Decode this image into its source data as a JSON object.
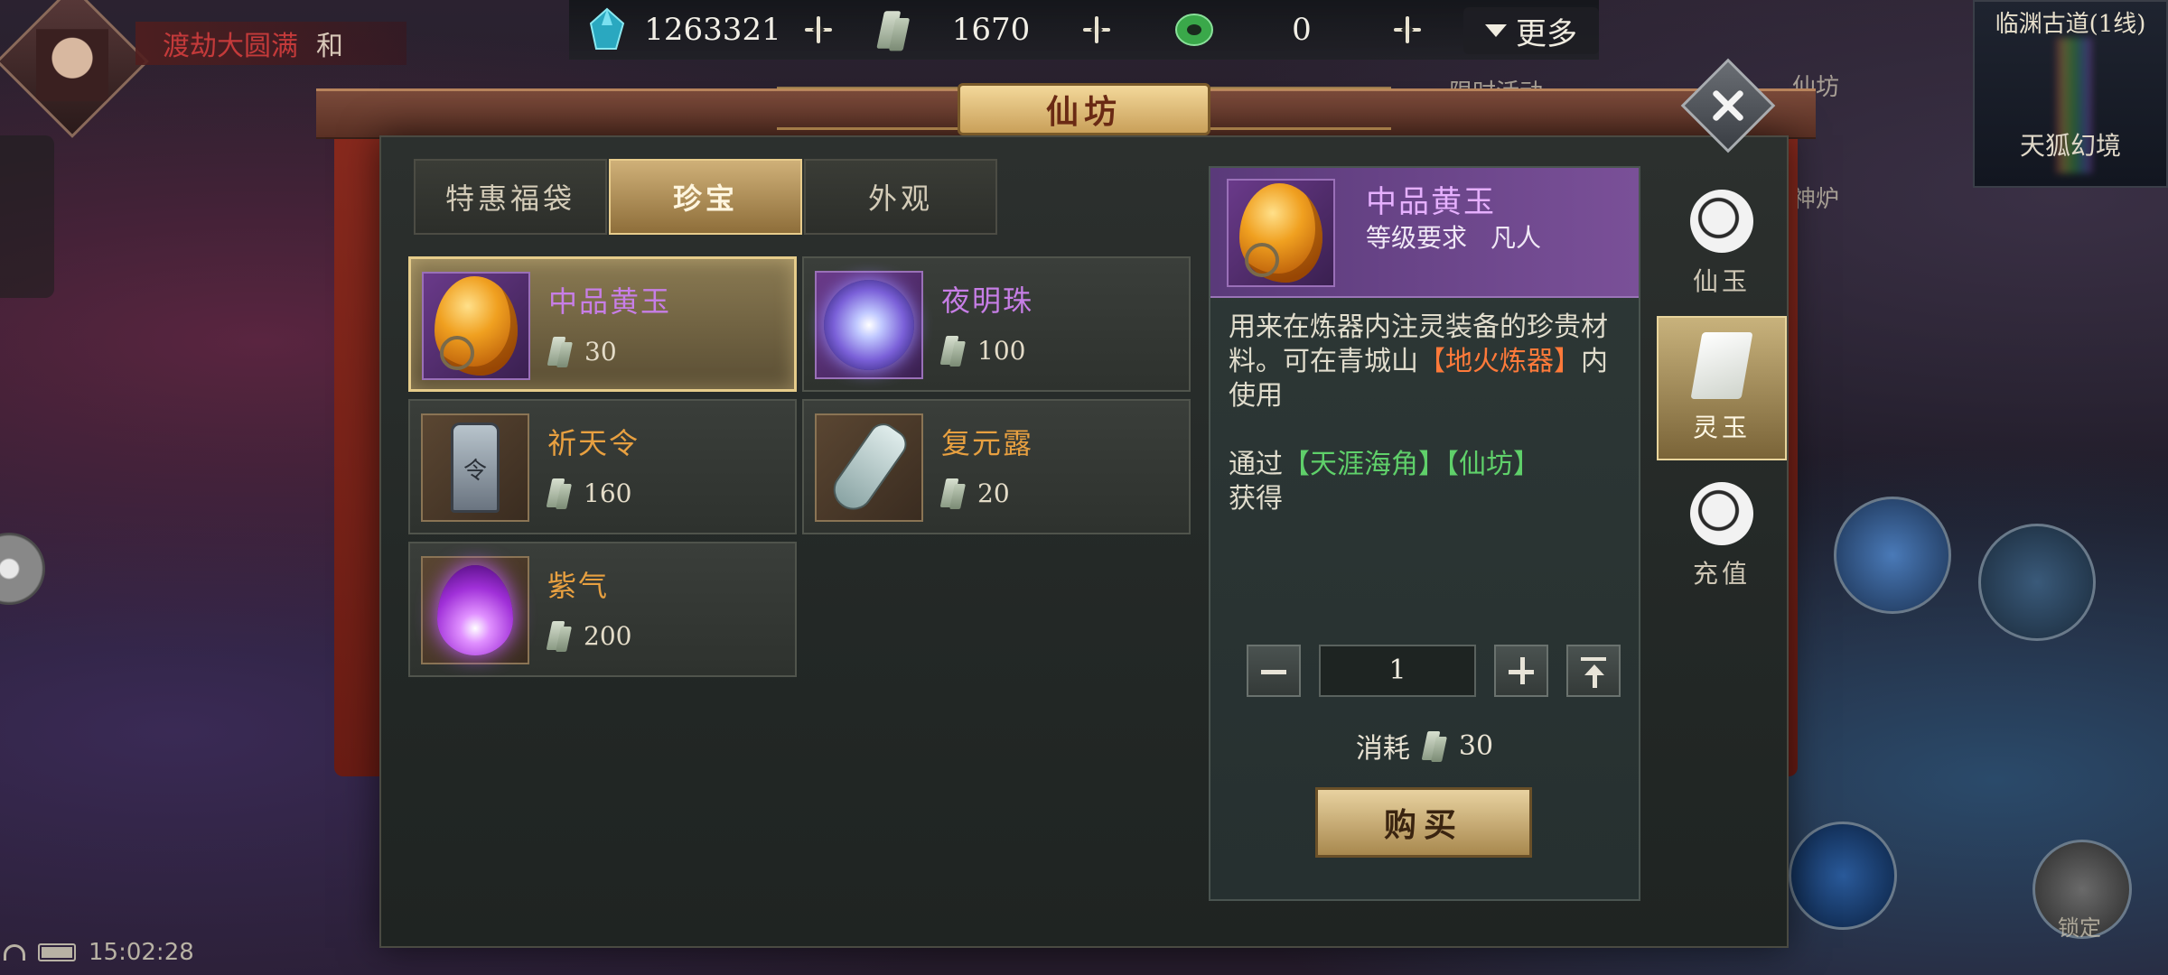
{
  "player": {
    "realm": "渡劫大圆满",
    "server_tag": "和"
  },
  "currencies": [
    {
      "name": "spirit-crystal",
      "value": "1263321",
      "icon": "crystal-icon",
      "color": "#3ab8c8"
    },
    {
      "name": "spirit-jade",
      "value": "1670",
      "icon": "jade-token-icon",
      "color": "#c0ccb8"
    },
    {
      "name": "jade-ring",
      "value": "0",
      "icon": "jade-ring-icon",
      "color": "#4ac060"
    }
  ],
  "more_label": "更多",
  "hud": {
    "limited_event": "限时活动",
    "xian_fang": "仙坊",
    "shen_lu": "神炉",
    "location": "临渊古道(1线)",
    "dungeon": "天狐幻境",
    "lock": "锁定",
    "time": "15:02:28"
  },
  "shop": {
    "title": "仙坊",
    "tabs": [
      {
        "label": "特惠福袋",
        "active": false
      },
      {
        "label": "珍宝",
        "active": true
      },
      {
        "label": "外观",
        "active": false
      }
    ],
    "items": [
      {
        "name": "中品黄玉",
        "price": "30",
        "rarity": "purple",
        "art": "amber",
        "selected": true
      },
      {
        "name": "夜明珠",
        "price": "100",
        "rarity": "purple",
        "art": "pearl",
        "selected": false
      },
      {
        "name": "祈天令",
        "price": "160",
        "rarity": "orange",
        "art": "tablet",
        "selected": false
      },
      {
        "name": "复元露",
        "price": "20",
        "rarity": "orange",
        "art": "vial",
        "selected": false
      },
      {
        "name": "紫气",
        "price": "200",
        "rarity": "orange",
        "art": "flame",
        "selected": false
      }
    ],
    "detail": {
      "name": "中品黄玉",
      "req_label": "等级要求",
      "req_value": "凡人",
      "desc_plain": "用来在炼器内注灵装备的珍贵材料。可在青城山",
      "desc_highlight": "【地火炼器】",
      "desc_tail": "内使用",
      "source_prefix": "通过",
      "source_a": "【天涯海角】",
      "source_b": "【仙坊】",
      "source_suffix": "获得",
      "quantity": "1",
      "cost_label": "消耗",
      "cost_value": "30",
      "buy_label": "购买"
    },
    "categories": [
      {
        "label": "仙玉",
        "icon": "xianyu-icon",
        "active": false
      },
      {
        "label": "灵玉",
        "icon": "lingyu-icon",
        "active": true
      },
      {
        "label": "充值",
        "icon": "recharge-icon",
        "active": false
      }
    ]
  }
}
